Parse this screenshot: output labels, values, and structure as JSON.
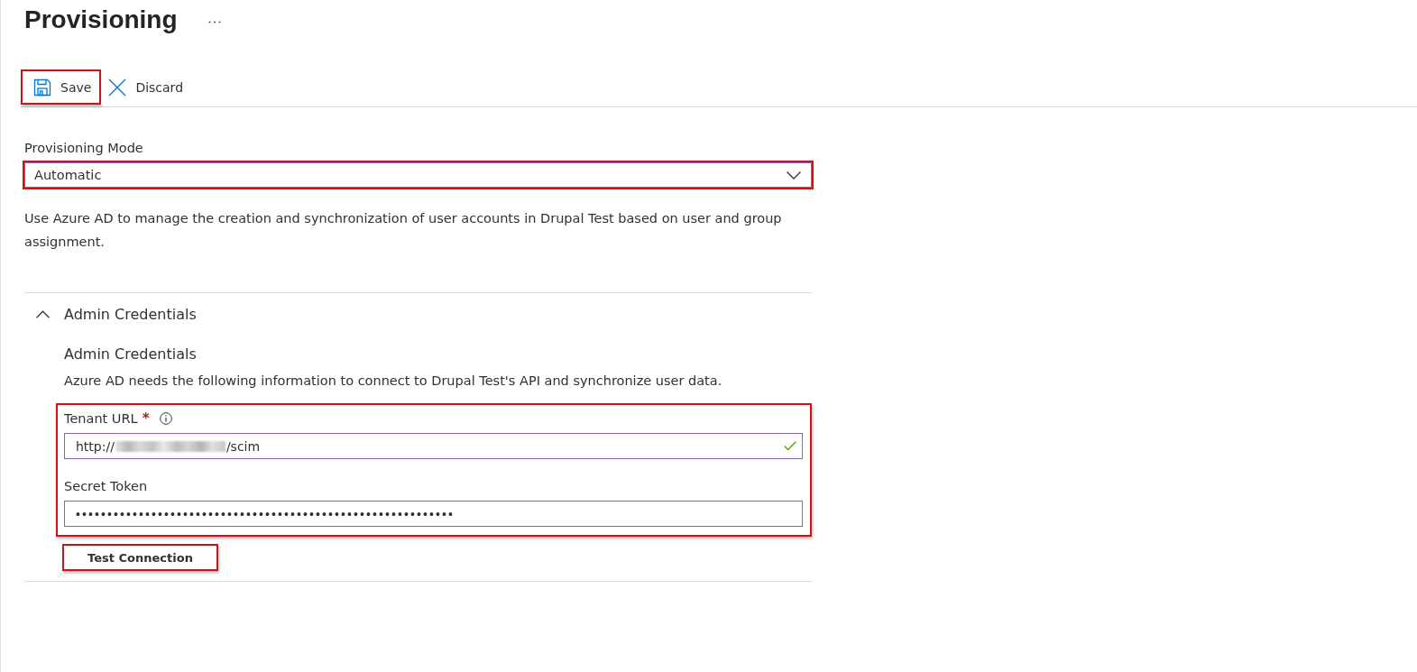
{
  "page": {
    "title": "Provisioning"
  },
  "toolbar": {
    "buttons": [
      {
        "kind": "save",
        "label": "Save",
        "highlighted": true
      },
      {
        "kind": "discard",
        "label": "Discard",
        "highlighted": false
      }
    ]
  },
  "mode": {
    "label": "Provisioning Mode",
    "value": "Automatic",
    "highlighted": true
  },
  "description": "Use Azure AD to manage the creation and synchronization of user accounts in Drupal Test based on user and group assignment.",
  "credentials": {
    "header": "Admin Credentials",
    "expanded": true,
    "title": "Admin Credentials",
    "description": "Azure AD needs the following information to connect to Drupal Test's API and synchronize user data.",
    "highlighted": true,
    "required_mark": "*",
    "fields": [
      {
        "kind": "url",
        "label": "Tenant URL",
        "required": true,
        "info": true,
        "value_start": "http://",
        "redacted": true,
        "value_end": "/scim",
        "valid": true
      },
      {
        "kind": "password",
        "label": "Secret Token",
        "required": false,
        "info": false,
        "value_start": "••••••••••••••••••••••••••••••••••••••••••••••••••••••••••••",
        "redacted": false,
        "valid": false
      }
    ],
    "test_button": {
      "label": "Test Connection",
      "highlighted": true
    }
  }
}
